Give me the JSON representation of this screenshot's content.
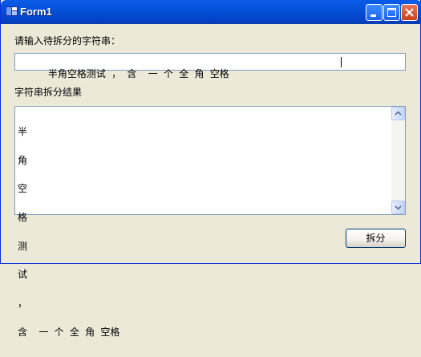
{
  "window": {
    "title": "Form1",
    "icon": "vb-form-icon",
    "controls": [
      "minimize-icon",
      "maximize-icon",
      "close-icon"
    ]
  },
  "form": {
    "input_label": "请输入待拆分的字符串：",
    "input_value": "半角空格测试 ， 含  一 个 全 角 空格",
    "result_label": "字符串拆分结果",
    "result_lines": [
      "半",
      "角",
      "空",
      "格",
      "测",
      "试",
      "，",
      "含  一 个 全 角 空格"
    ],
    "split_button": "拆分"
  },
  "colors": {
    "titlebar": "#0450d8",
    "window_bg": "#ece9d8",
    "border": "#7f9db9"
  }
}
